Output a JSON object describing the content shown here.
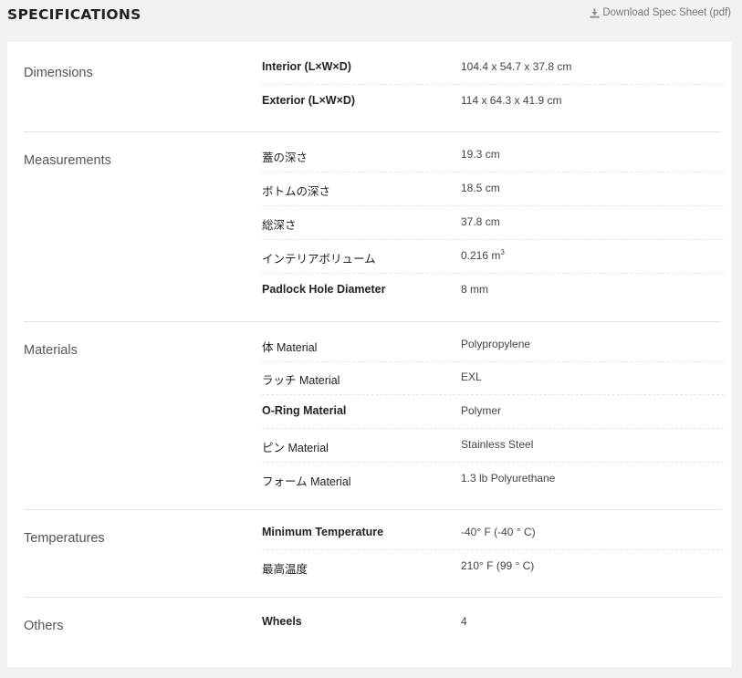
{
  "header": {
    "title": "SPECIFICATIONS",
    "download_label": "Download Spec Sheet (pdf)",
    "download_icon": "download-icon"
  },
  "groups": [
    {
      "title": "Dimensions",
      "rows": [
        {
          "label": "Interior (L×W×D)",
          "value": "104.4 x 54.7 x 37.8 cm"
        },
        {
          "label": "Exterior (L×W×D)",
          "value": "114 x 64.3 x 41.9 cm"
        }
      ]
    },
    {
      "title": "Measurements",
      "rows": [
        {
          "label": "蓋の深さ",
          "value": "19.3 cm"
        },
        {
          "label": "ボトムの深さ",
          "value": "18.5 cm"
        },
        {
          "label": "総深さ",
          "value": "37.8 cm"
        },
        {
          "label": "インテリアボリューム",
          "value": "0.216 m",
          "value_sup": "3"
        },
        {
          "label": "Padlock Hole Diameter",
          "value": "8 mm"
        }
      ]
    },
    {
      "title": "Materials",
      "rows": [
        {
          "label": "体 Material",
          "value": "Polypropylene"
        },
        {
          "label": "ラッチ Material",
          "value": "EXL"
        },
        {
          "label": "O-Ring Material",
          "value": "Polymer"
        },
        {
          "label": "ピン Material",
          "value": "Stainless Steel"
        },
        {
          "label": "フォーム Material",
          "value": "1.3 lb Polyurethane"
        }
      ]
    },
    {
      "title": "Temperatures",
      "rows": [
        {
          "label": "Minimum Temperature",
          "value": "-40° F (-40 ° C)"
        },
        {
          "label": "最高温度",
          "value": "210° F (99 ° C)"
        }
      ]
    },
    {
      "title": "Others",
      "rows": [
        {
          "label": "Wheels",
          "value": "4"
        }
      ]
    }
  ]
}
